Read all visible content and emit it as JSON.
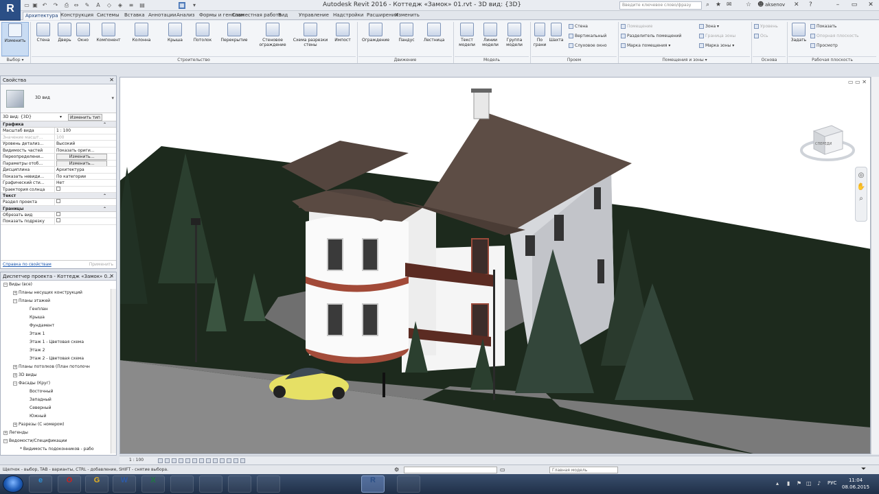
{
  "app": {
    "logo": "R",
    "window_title": "Autodesk Revit 2016 -   Коттедж «Замок» 01.rvt - 3D вид: {3D}",
    "search_placeholder": "Введите ключевое слово/фразу",
    "user": "aksenov"
  },
  "tabs": [
    "Архитектура",
    "Конструкция",
    "Системы",
    "Вставка",
    "Аннотации",
    "Анализ",
    "Формы и генплан",
    "Совместная работа",
    "Вид",
    "Управление",
    "Надстройки",
    "Расширения",
    "Изменить"
  ],
  "ribbon": {
    "modify_label": "Изменить",
    "select_label": "Выбор ▾",
    "build_buttons": [
      "Стена",
      "Дверь",
      "Окно",
      "Компонент",
      "Колонна",
      "Крыша",
      "Потолок",
      "Перекрытие",
      "Стеновое ограждение",
      "Схема разрезки стены",
      "Импост"
    ],
    "circulation_buttons": [
      "Ограждение",
      "Пандус",
      "Лестница"
    ],
    "model_buttons": [
      "Текст модели",
      "Линии модели",
      "Группа модели"
    ],
    "opening_buttons": [
      "По грани",
      "Шахта"
    ],
    "opening_small": [
      "Стена",
      "Вертикальный",
      "Слуховое окно"
    ],
    "room_small": [
      "Помещение",
      "Разделитель помещений",
      "Марка помещения ▾"
    ],
    "area_small": [
      "Зона ▾",
      "Граница зоны",
      "Марка зоны ▾"
    ],
    "datum_small": [
      "Уровень",
      "Ось"
    ],
    "workplane_button": "Задать",
    "workplane_small": [
      "Показать",
      "Опорная плоскость",
      "Просмотр"
    ],
    "panels": [
      "Строительство",
      "Движение",
      "Модель",
      "Проем",
      "Помещения и зоны ▾",
      "Основа",
      "Рабочая плоскость"
    ]
  },
  "properties": {
    "title": "Свойства",
    "type_name": "3D вид",
    "view_selector": "3D вид: {3D}",
    "edit_type": "Изменить тип",
    "groups": {
      "graphics": "Графика",
      "text": "Текст",
      "extents": "Границы"
    },
    "rows": [
      {
        "name": "Масштаб вида",
        "value": "1 : 100"
      },
      {
        "name": "Значение масшт...",
        "value": "100",
        "dim": true
      },
      {
        "name": "Уровень детализ...",
        "value": "Высокий"
      },
      {
        "name": "Видимость частей",
        "value": "Показать ориги..."
      },
      {
        "name": "Переопределени...",
        "value": "Изменить..."
      },
      {
        "name": "Параметры отоб...",
        "value": "Изменить..."
      },
      {
        "name": "Дисциплина",
        "value": "Архитектура"
      },
      {
        "name": "Показать невиди...",
        "value": "По категории"
      },
      {
        "name": "Графический сти...",
        "value": "Нет"
      },
      {
        "name": "Траектория солнца",
        "value": ""
      }
    ],
    "text_rows": [
      {
        "name": "Раздел проекта",
        "value": ""
      }
    ],
    "extent_rows": [
      {
        "name": "Обрезать вид",
        "value": ""
      },
      {
        "name": "Показать подрезку",
        "value": ""
      }
    ],
    "help": "Справка по свойствам",
    "apply": "Применить"
  },
  "browser": {
    "title": "Диспетчер проекта - Коттедж «Замок» 0...",
    "items": [
      {
        "label": "Виды (все)",
        "level": 0,
        "toggle": "−"
      },
      {
        "label": "Планы несущих конструкций",
        "level": 1,
        "toggle": "+"
      },
      {
        "label": "Планы этажей",
        "level": 1,
        "toggle": "−"
      },
      {
        "label": "Генплан",
        "level": 2
      },
      {
        "label": "Крыша",
        "level": 2
      },
      {
        "label": "Фундамент",
        "level": 2
      },
      {
        "label": "Этаж 1",
        "level": 2
      },
      {
        "label": "Этаж 1 - Цветовая схема",
        "level": 2
      },
      {
        "label": "Этаж 2",
        "level": 2
      },
      {
        "label": "Этаж 2 - Цветовая схема",
        "level": 2
      },
      {
        "label": "Планы потолков (План потолочн",
        "level": 1,
        "toggle": "+"
      },
      {
        "label": "3D виды",
        "level": 1,
        "toggle": "+"
      },
      {
        "label": "Фасады (Круг)",
        "level": 1,
        "toggle": "−"
      },
      {
        "label": "Восточный",
        "level": 2
      },
      {
        "label": "Западный",
        "level": 2
      },
      {
        "label": "Северный",
        "level": 2
      },
      {
        "label": "Южный",
        "level": 2
      },
      {
        "label": "Разрезы (С номером)",
        "level": 1,
        "toggle": "+"
      },
      {
        "label": "Легенды",
        "level": 0,
        "toggle": "+"
      },
      {
        "label": "Ведомости/Спецификации",
        "level": 0,
        "toggle": "−"
      },
      {
        "label": "* Видимость подоконников - рабо",
        "level": 1
      }
    ]
  },
  "viewcube_label": "СПЕРЕДИ",
  "viewbar": {
    "scale": "1 : 100"
  },
  "status": {
    "text": "Щелчок - выбор, TAB - варианты, CTRL - добавление, SHIFT - снятие выбора.",
    "model": "Главная модель"
  },
  "taskbar": {
    "apps": [
      "e",
      "O",
      "G",
      "W",
      "X",
      "",
      "",
      "",
      "",
      "R",
      ""
    ],
    "lang": "РУС",
    "time": "11:04",
    "date": "08.06.2015"
  },
  "colors": {
    "accent": "#2b4f86",
    "grass": "#1d2a1d",
    "roof": "#5a4a42",
    "wall": "#f4f4f4"
  }
}
